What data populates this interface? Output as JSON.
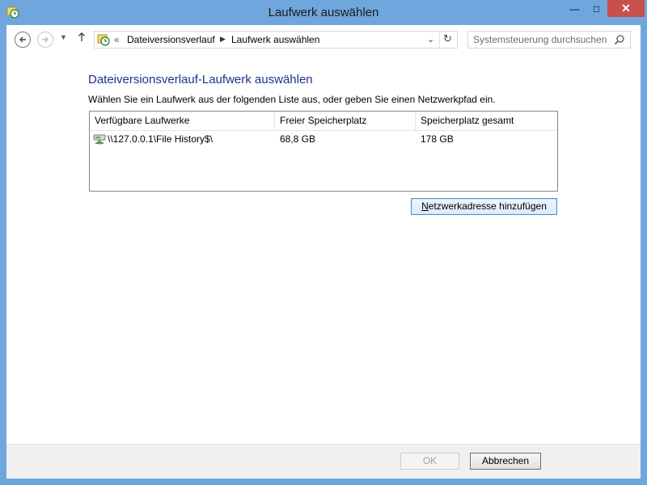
{
  "window": {
    "title": "Laufwerk auswählen",
    "minimize": "—",
    "maximize": "□",
    "close": "✕"
  },
  "navigation": {
    "breadcrumb_overflow": "«",
    "breadcrumbs": [
      "Dateiversionsverlauf",
      "Laufwerk auswählen"
    ],
    "search_placeholder": "Systemsteuerung durchsuchen"
  },
  "content": {
    "heading": "Dateiversionsverlauf-Laufwerk auswählen",
    "instructions": "Wählen Sie ein Laufwerk aus der folgenden Liste aus, oder geben Sie einen Netzwerkpfad ein.",
    "columns": [
      "Verfügbare Laufwerke",
      "Freier Speicherplatz",
      "Speicherplatz gesamt"
    ],
    "rows": [
      {
        "name": "\\\\127.0.0.1\\File History$\\",
        "free": "68,8 GB",
        "total": "178 GB"
      }
    ],
    "add_network_button_mnemonic": "N",
    "add_network_button_rest": "etzwerkadresse hinzufügen"
  },
  "footer": {
    "ok": "OK",
    "cancel": "Abbrechen"
  },
  "colors": {
    "frame": "#6ea6dd",
    "close": "#c7504b",
    "heading": "#1e3287"
  }
}
